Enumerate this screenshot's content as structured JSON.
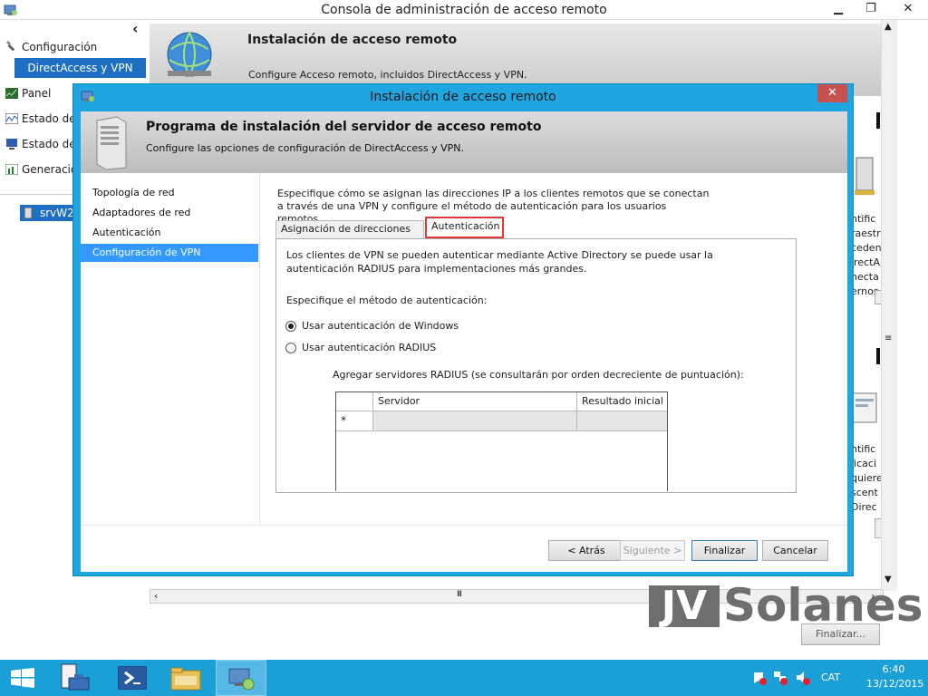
{
  "main_window": {
    "title": "Consola de administración de acceso remoto",
    "minimize": "▁",
    "maximize": "❐",
    "close": "✕",
    "collapse_pane": "‹"
  },
  "left_tree": {
    "items": [
      {
        "label": "Configuración",
        "icon": "tools-icon"
      },
      {
        "label": "DirectAccess y VPN",
        "selected": true
      },
      {
        "label": "Panel",
        "icon": "dashboard-icon"
      },
      {
        "label": "Estado de",
        "icon": "operations-status-icon"
      },
      {
        "label": "Estado de",
        "icon": "client-status-icon"
      },
      {
        "label": "Generació",
        "icon": "reporting-icon"
      },
      {
        "label": "srvW2",
        "icon": "server-icon"
      }
    ]
  },
  "main_banner": {
    "title": "Instalación de acceso remoto",
    "subtitle": "Configure Acceso remoto, incluidos DirectAccess y VPN."
  },
  "right_fragments": {
    "lines_1": [
      "ntific",
      "raestr",
      "ceden",
      "irectA",
      "necta",
      "ernos"
    ],
    "lines_2": [
      "ntific",
      "licaci",
      "quiere",
      "scent",
      "Direc"
    ]
  },
  "dialog": {
    "title": "Instalación de acceso remoto",
    "close": "✕",
    "header_title": "Programa de instalación del servidor de acceso remoto",
    "header_subtitle": "Configure las opciones de configuración de DirectAccess y VPN.",
    "nav": [
      {
        "label": "Topología de red",
        "selected": false
      },
      {
        "label": "Adaptadores de red",
        "selected": false
      },
      {
        "label": "Autenticación",
        "selected": false
      },
      {
        "label": "Configuración de VPN",
        "selected": true
      }
    ],
    "intro": "Especifique cómo se asignan las direcciones IP a los clientes remotos que se conectan a través de una VPN y configure el método de autenticación para los usuarios remotos.",
    "tabs": [
      {
        "label": "Asignación de direcciones IP",
        "active": false
      },
      {
        "label": "Autenticación",
        "active": true
      }
    ],
    "auth": {
      "description": "Los clientes de VPN se pueden autenticar mediante Active Directory se puede usar la autenticación RADIUS para implementaciones más grandes.",
      "method_label": "Especifique el método de autenticación:",
      "options": [
        {
          "label": "Usar autenticación de Windows",
          "checked": true
        },
        {
          "label": "Usar autenticación RADIUS",
          "checked": false
        }
      ],
      "radius_label": "Agregar servidores RADIUS (se consultarán por orden decreciente de puntuación):",
      "grid_columns": [
        "Servidor",
        "Resultado inicial"
      ],
      "grid_new_row_marker": "*"
    },
    "buttons": {
      "back": "< Atrás",
      "next": "Siguiente >",
      "finish": "Finalizar",
      "cancel": "Cancelar"
    }
  },
  "background_finish_button": "Finalizar...",
  "hscroll_thumb": "III",
  "watermark": {
    "prefix": "JV",
    "suffix": "Solanes"
  },
  "taskbar": {
    "language": "CAT",
    "time": "6:40",
    "date": "13/12/2015"
  }
}
